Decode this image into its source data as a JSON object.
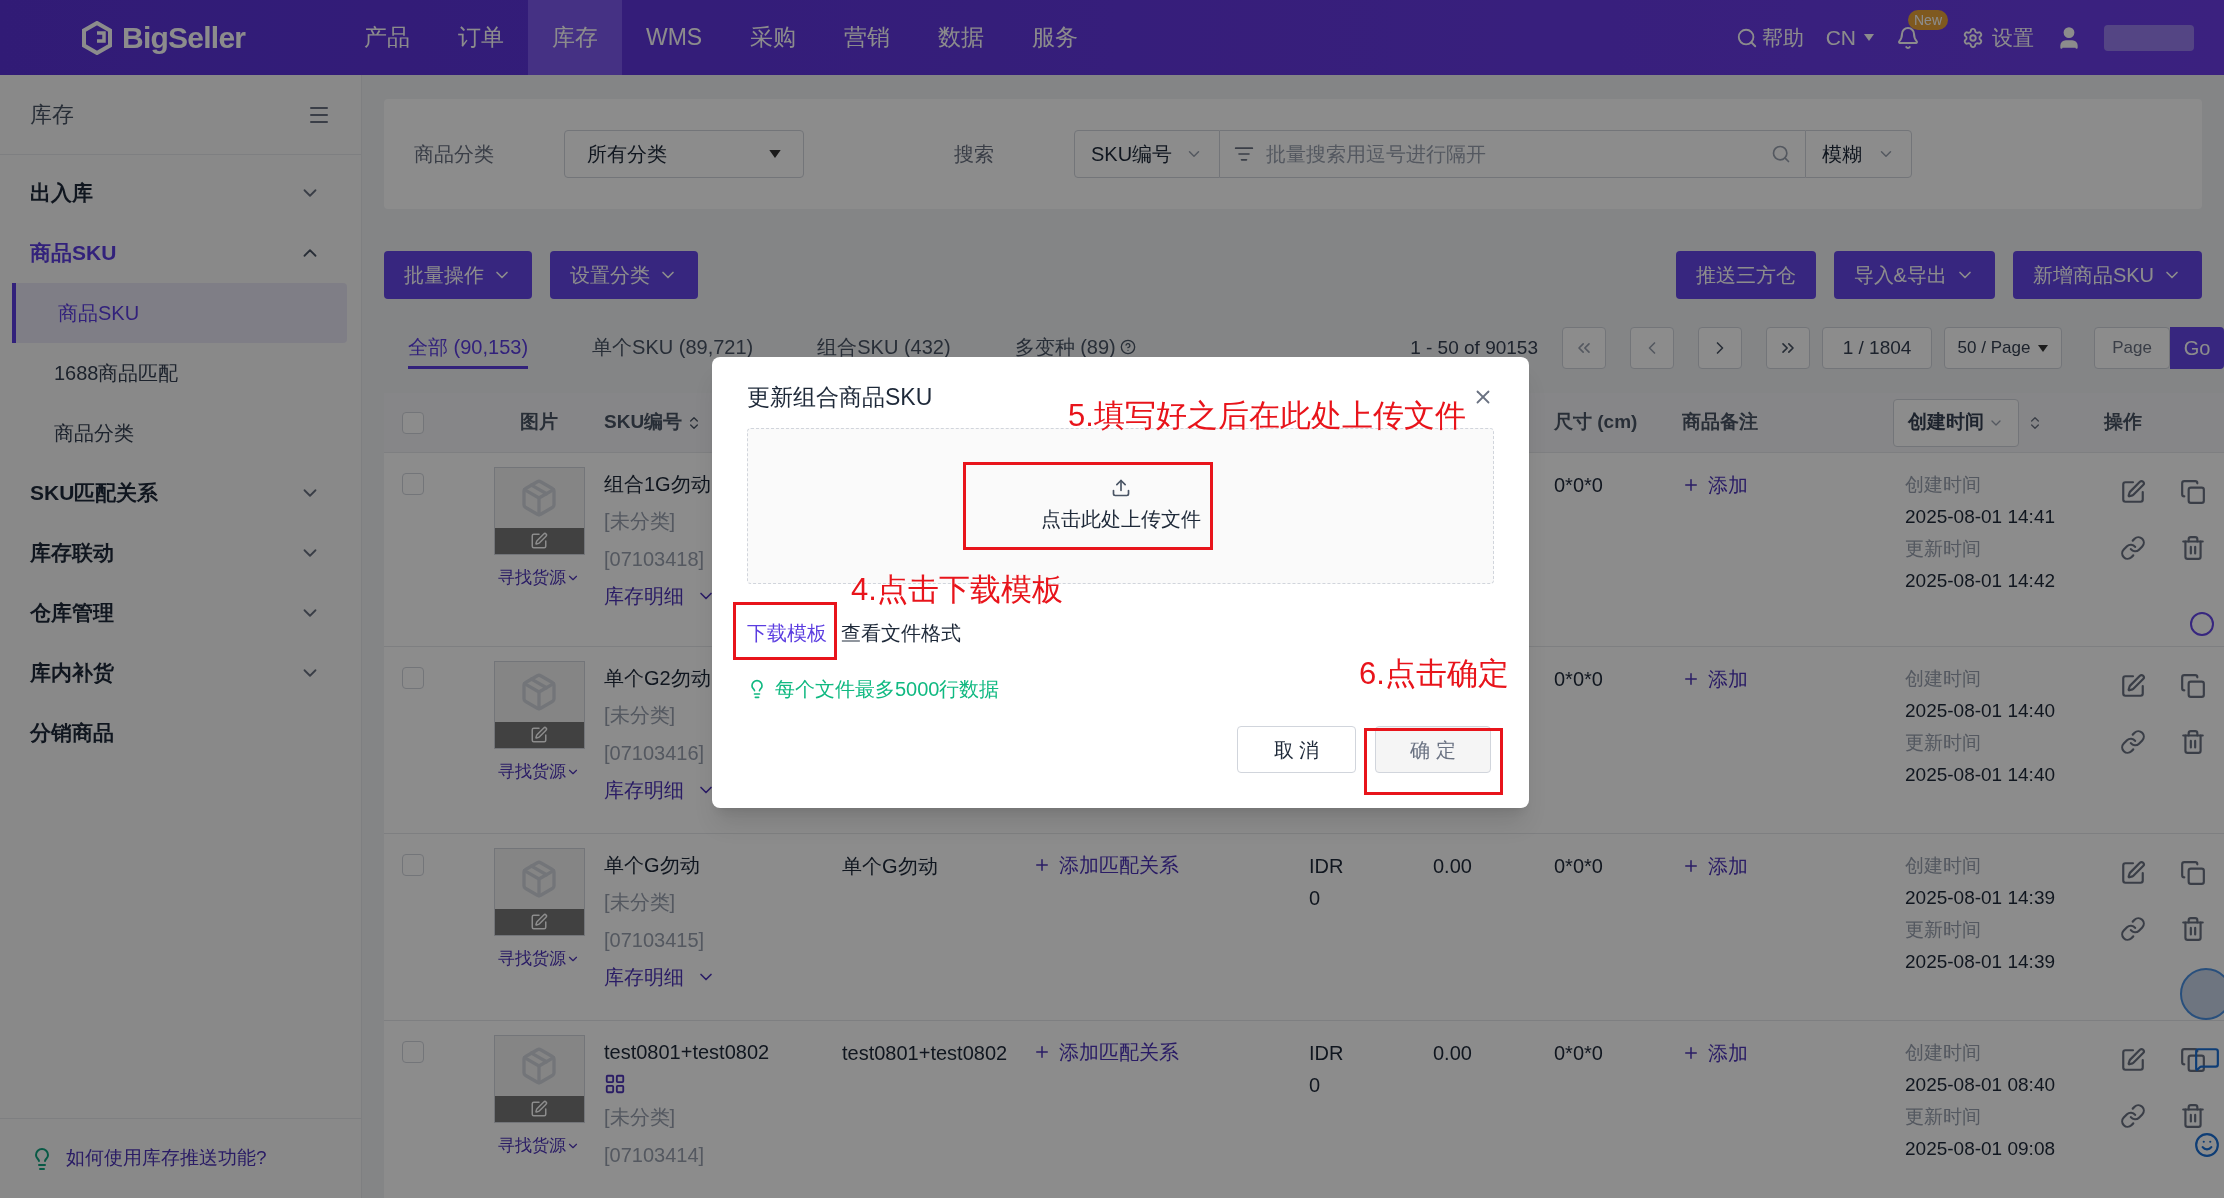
{
  "top_nav": {
    "brand": "BigSeller",
    "menu": [
      {
        "label": "产品",
        "selected": false
      },
      {
        "label": "订单",
        "selected": false
      },
      {
        "label": "库存",
        "selected": true
      },
      {
        "label": "WMS",
        "selected": false
      },
      {
        "label": "采购",
        "selected": false
      },
      {
        "label": "营销",
        "selected": false
      },
      {
        "label": "数据",
        "selected": false
      },
      {
        "label": "服务",
        "selected": false
      }
    ],
    "help": "帮助",
    "language": "CN",
    "badge": "New",
    "settings": "设置"
  },
  "sidebar": {
    "title": "库存",
    "items": [
      {
        "label": "出入库",
        "kind": "group",
        "expanded": false
      },
      {
        "label": "商品SKU",
        "kind": "group",
        "expanded": true,
        "children": [
          {
            "label": "商品SKU",
            "selected": true
          },
          {
            "label": "1688商品匹配",
            "selected": false
          },
          {
            "label": "商品分类",
            "selected": false
          }
        ]
      },
      {
        "label": "SKU匹配关系",
        "kind": "group",
        "expanded": false
      },
      {
        "label": "库存联动",
        "kind": "group",
        "expanded": false
      },
      {
        "label": "仓库管理",
        "kind": "group",
        "expanded": false
      },
      {
        "label": "库内补货",
        "kind": "group",
        "expanded": false
      },
      {
        "label": "分销商品",
        "kind": "link"
      }
    ],
    "help_link": "如何使用库存推送功能?"
  },
  "filters": {
    "category_label": "商品分类",
    "category_value": "所有分类",
    "search_label": "搜索",
    "search_field": "SKU编号",
    "search_placeholder": "批量搜索用逗号进行隔开",
    "match_mode": "模糊"
  },
  "toolbar": {
    "left": [
      {
        "label": "批量操作",
        "dropdown": true
      },
      {
        "label": "设置分类",
        "dropdown": true
      }
    ],
    "right": [
      {
        "label": "推送三方仓",
        "dropdown": false
      },
      {
        "label": "导入&导出",
        "dropdown": true
      },
      {
        "label": "新增商品SKU",
        "dropdown": true
      }
    ]
  },
  "tabs": [
    {
      "label": "全部 (90,153)",
      "selected": true,
      "help": false
    },
    {
      "label": "单个SKU (89,721)",
      "selected": false,
      "help": false
    },
    {
      "label": "组合SKU (432)",
      "selected": false,
      "help": false
    },
    {
      "label": "多变种 (89)",
      "selected": false,
      "help": true
    }
  ],
  "pagination": {
    "range": "1 - 50 of 90153",
    "page": "1 / 1804",
    "page_size": "50 / Page",
    "page_placeholder": "Page",
    "go": "Go"
  },
  "table": {
    "header": {
      "select_all_checked": false,
      "image": "图片",
      "sku": "SKU编号",
      "size": "尺寸 (cm)",
      "memo": "商品备注",
      "sort_select": "创建时间",
      "actions": "操作"
    },
    "rows": [
      {
        "checked": false,
        "name": "组合1G勿动",
        "combo": false,
        "category": "[未分类]",
        "code": "[07103418]",
        "source_link": "寻找货源",
        "stock_detail": "库存明细",
        "size": "0*0*0",
        "memo_link": "添加",
        "created_label": "创建时间",
        "created": "2025-08-01 14:41",
        "updated_label": "更新时间",
        "updated": "2025-08-01 14:42"
      },
      {
        "checked": false,
        "name": "单个G2勿动",
        "combo": false,
        "category": "[未分类]",
        "code": "[07103416]",
        "source_link": "寻找货源",
        "stock_detail": "库存明细",
        "size": "0*0*0",
        "memo_link": "添加",
        "created_label": "创建时间",
        "created": "2025-08-01 14:40",
        "updated_label": "更新时间",
        "updated": "2025-08-01 14:40"
      },
      {
        "checked": false,
        "name": "单个G勿动",
        "combo": false,
        "category": "[未分类]",
        "code": "[07103415]",
        "source_link": "寻找货源",
        "stock_detail": "库存明细",
        "title": "单个G勿动",
        "match_link": "添加匹配关系",
        "currency": "IDR",
        "price": "0",
        "weight": "0.00",
        "size": "0*0*0",
        "memo_link": "添加",
        "created_label": "创建时间",
        "created": "2025-08-01 14:39",
        "updated_label": "更新时间",
        "updated": "2025-08-01 14:39"
      },
      {
        "checked": false,
        "name": "test0801+test0802",
        "combo": true,
        "category": "[未分类]",
        "code": "[07103414]",
        "source_link": "寻找货源",
        "title": "test0801+test0802",
        "match_link": "添加匹配关系",
        "currency": "IDR",
        "price": "0",
        "weight": "0.00",
        "size": "0*0*0",
        "memo_link": "添加",
        "created_label": "创建时间",
        "created": "2025-08-01 08:40",
        "updated_label": "更新时间",
        "updated": "2025-08-01 09:08"
      }
    ]
  },
  "modal": {
    "title": "更新组合商品SKU",
    "upload_text": "点击此处上传文件",
    "template_link": "下载模板",
    "format_text": "查看文件格式",
    "tip": "每个文件最多5000行数据",
    "cancel": "取 消",
    "confirm": "确 定",
    "confirm_disabled": true,
    "annotations": [
      {
        "kind": "upload",
        "text": "5.填写好之后在此处上传文件"
      },
      {
        "kind": "template",
        "text": "4.点击下载模板"
      },
      {
        "kind": "confirm",
        "text": "6.点击确定"
      }
    ]
  }
}
